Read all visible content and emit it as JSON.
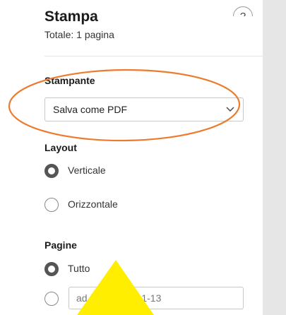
{
  "dialog": {
    "title": "Stampa",
    "subtitle": "Totale: 1 pagina",
    "help_icon": "question-mark-icon",
    "help_glyph": "?"
  },
  "printer": {
    "label": "Stampante",
    "selected": "Salva come PDF",
    "dropdown_icon": "chevron-down-icon"
  },
  "layout": {
    "label": "Layout",
    "options": [
      {
        "label": "Verticale",
        "checked": true
      },
      {
        "label": "Orizzontale",
        "checked": false
      }
    ]
  },
  "pages": {
    "label": "Pagine",
    "options": [
      {
        "label": "Tutto",
        "checked": true
      },
      {
        "label": "",
        "checked": false
      }
    ],
    "custom_placeholder": "ad es. 1-5, 8, 11-13"
  },
  "annotations": {
    "highlight_color": "#ec7b2e",
    "arrow_color": "#ffee00"
  },
  "colors": {
    "preview_background": "#e6e6e6",
    "radio_checked": "#555555"
  }
}
